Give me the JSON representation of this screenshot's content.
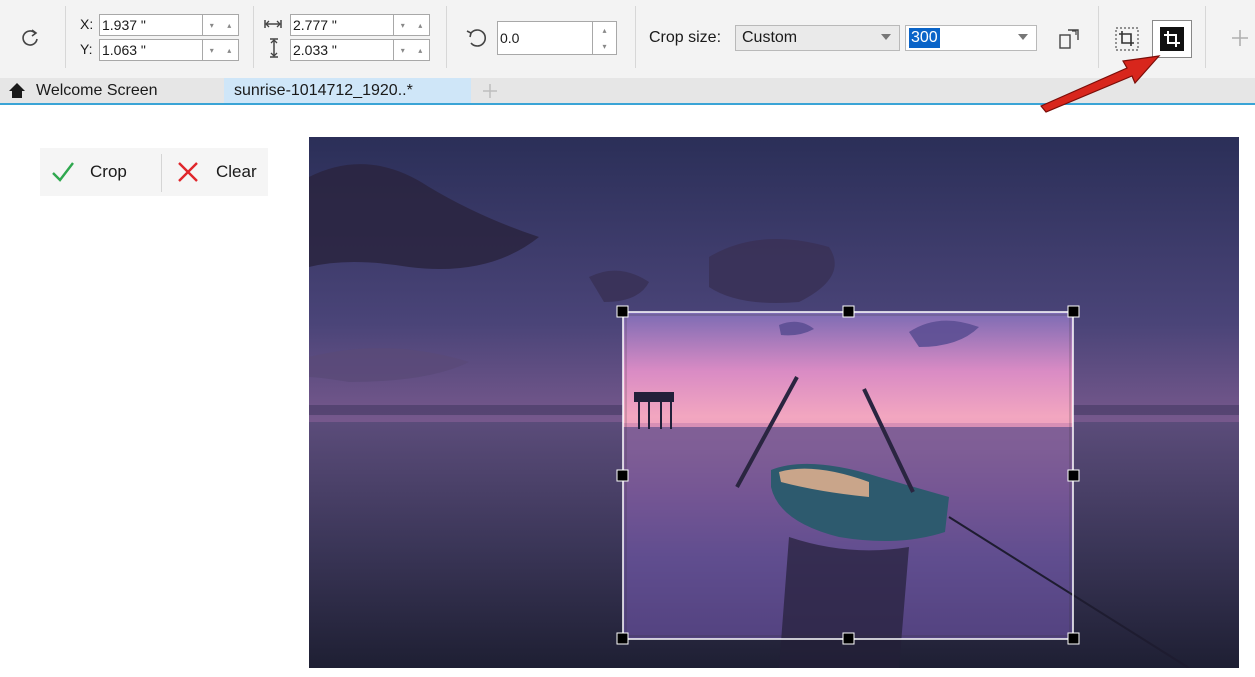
{
  "propbar": {
    "x_label": "X:",
    "x_value": "1.937 \"",
    "y_label": "Y:",
    "y_value": "1.063 \"",
    "width_value": "2.777 \"",
    "height_value": "2.033 \"",
    "rotation_value": "0.0",
    "crop_size_label": "Crop size:",
    "crop_size_value": "Custom",
    "resolution_value": "300"
  },
  "tabs": [
    {
      "label": "Welcome Screen"
    },
    {
      "label": "sunrise-1014712_1920..*"
    }
  ],
  "crop_toolbar": {
    "crop_label": "Crop",
    "clear_label": "Clear"
  },
  "colors": {
    "accent": "#3aa4d6",
    "selection": "#0a64c8",
    "check": "#2fa84f",
    "clear": "#e0262b",
    "arrow": "#d8261c"
  },
  "icons": [
    "rotate-icon",
    "width-icon",
    "height-icon",
    "angle-icon",
    "swap-orientation-icon",
    "crop-inside-icon",
    "crop-outside-icon",
    "add-icon",
    "home-icon",
    "check-icon",
    "x-icon"
  ]
}
